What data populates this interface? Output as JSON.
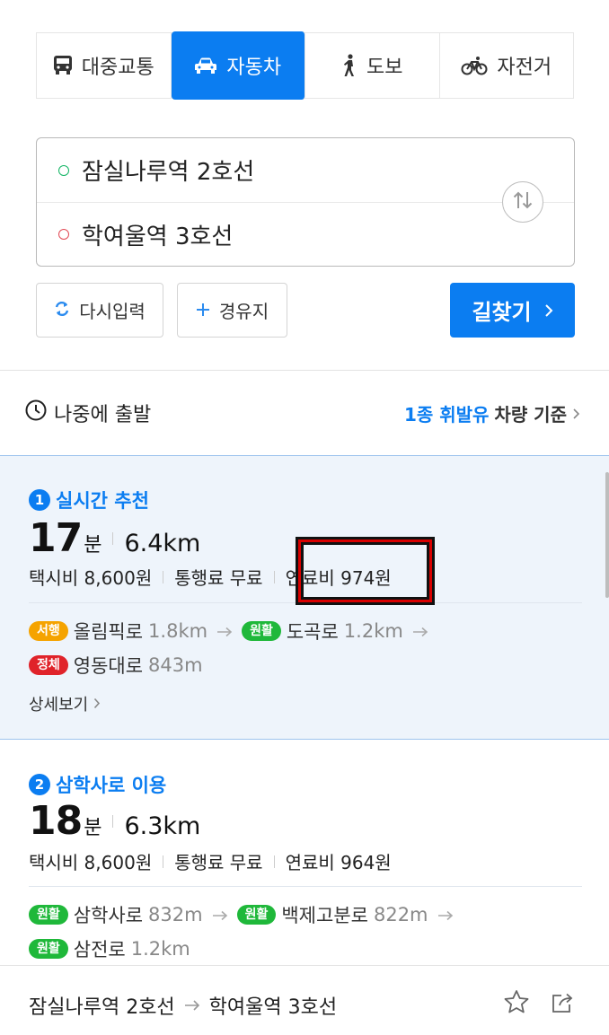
{
  "tabs": [
    {
      "label": "대중교통",
      "icon": "bus-icon",
      "active": false
    },
    {
      "label": "자동차",
      "icon": "car-icon",
      "active": true
    },
    {
      "label": "도보",
      "icon": "walk-icon",
      "active": false
    },
    {
      "label": "자전거",
      "icon": "bike-icon",
      "active": false
    }
  ],
  "route_input": {
    "origin": "잠실나루역 2호선",
    "destination": "학여울역 3호선"
  },
  "actions": {
    "reset_label": "다시입력",
    "waypoint_label": "경유지",
    "search_label": "길찾기"
  },
  "depart": {
    "label": "나중에 출발",
    "fuel_type": "1종 휘발유",
    "fuel_basis_suffix": "차량 기준"
  },
  "routes": [
    {
      "rank": "1",
      "title": "실시간 추천",
      "minutes": "17",
      "minutes_unit": "분",
      "distance": "6.4km",
      "taxi_fare": "택시비 8,600원",
      "toll": "통행료 무료",
      "fuel_cost": "연료비 974원",
      "segments": [
        {
          "status": "서행",
          "road": "올림픽로",
          "length": "1.8km"
        },
        {
          "status": "원활",
          "road": "도곡로",
          "length": "1.2km"
        },
        {
          "status": "정체",
          "road": "영동대로",
          "length": "843m"
        }
      ],
      "detail_label": "상세보기"
    },
    {
      "rank": "2",
      "title": "삼학사로 이용",
      "minutes": "18",
      "minutes_unit": "분",
      "distance": "6.3km",
      "taxi_fare": "택시비 8,600원",
      "toll": "통행료 무료",
      "fuel_cost": "연료비 964원",
      "segments": [
        {
          "status": "원활",
          "road": "삼학사로",
          "length": "832m"
        },
        {
          "status": "원활",
          "road": "백제고분로",
          "length": "822m"
        },
        {
          "status": "원활",
          "road": "삼전로",
          "length": "1.2km"
        }
      ]
    }
  ],
  "bottom_bar": {
    "origin": "잠실나루역 2호선",
    "destination": "학여울역 3호선"
  },
  "colors": {
    "accent": "#0b7df1",
    "slow": "#f5a300",
    "smooth": "#1fb83a",
    "jam": "#e0232a",
    "highlight_box": "#d90000"
  }
}
